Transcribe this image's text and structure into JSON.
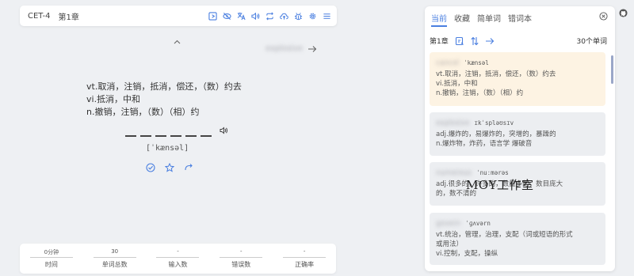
{
  "header": {
    "dictionary": "CET-4",
    "chapter": "第1章",
    "icons": [
      "list-icon",
      "eye-off-icon",
      "translate-icon",
      "volume-icon",
      "repeat-icon",
      "cloud-upload-icon",
      "bug-icon",
      "settings-icon",
      "menu-icon"
    ]
  },
  "next_word": {
    "word": "",
    "arrow": "arrow-right-icon"
  },
  "word": {
    "definitions": [
      "vt.取消，注销，抵消，偿还，（数）约去",
      "vi.抵消，中和",
      "n.撤销，注销，（数）（相）约"
    ],
    "phonetic": "[ˈkænsəl]",
    "letter_count": 6
  },
  "stats": [
    {
      "value": "0分钟",
      "label": "时间"
    },
    {
      "value": "30",
      "label": "单词总数"
    },
    {
      "value": "-",
      "label": "输入数"
    },
    {
      "value": "-",
      "label": "错误数"
    },
    {
      "value": "-",
      "label": "正确率"
    }
  ],
  "panel": {
    "tabs": [
      "当前",
      "收藏",
      "简单词",
      "错词本"
    ],
    "active_tab": "当前",
    "chapter": "第1章",
    "count": "30个单词",
    "cards": [
      {
        "phonetic": "ˈkænsəl",
        "defs": [
          "vt.取消，注销，抵消，偿还，（数）约去",
          "vi.抵消，中和",
          "n.撤销，注销，（数）（相）约"
        ],
        "current": true
      },
      {
        "phonetic": "ɪkˈspləʊsɪv",
        "defs": [
          "adj.爆炸的，易爆炸的，突增的，暴躁的",
          "n.爆炸物，炸药，语言学 爆破音"
        ],
        "current": false
      },
      {
        "phonetic": "ˈnuːmərəs",
        "defs": [
          "adj.很多的，许多的，数量多的，数目庞大",
          "的，数不清的"
        ],
        "current": false
      },
      {
        "phonetic": "ˈɡʌvərn",
        "defs": [
          "vt.统治，管理，治理，支配（词或短语的形式",
          "或用法）",
          "vi.控制，支配，操纵"
        ],
        "current": false
      }
    ]
  },
  "watermark": "MOY工作室",
  "colors": {
    "accent": "#4a7fe0",
    "current_card": "#fdf3e3",
    "card": "#eceef1"
  }
}
